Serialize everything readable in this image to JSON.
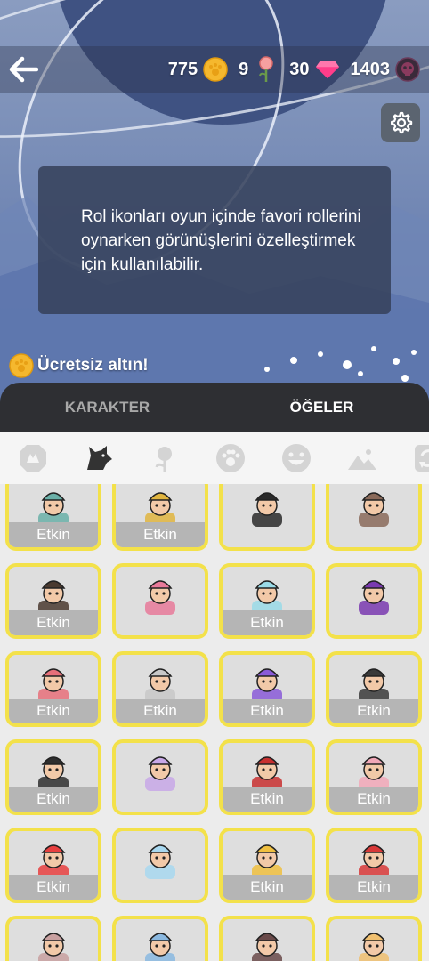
{
  "header": {
    "currency": [
      {
        "name": "gold",
        "value": "775",
        "icon": "gold-paw-coin-icon",
        "color": "#f5b82e"
      },
      {
        "name": "roses",
        "value": "9",
        "icon": "rose-icon",
        "color": "#f08a8a"
      },
      {
        "name": "gems",
        "value": "30",
        "icon": "gem-icon",
        "color": "#ff3d8a"
      },
      {
        "name": "skull-coins",
        "value": "1403",
        "icon": "skull-coin-icon",
        "color": "#7a2a4a"
      }
    ]
  },
  "info": {
    "text": "Rol ikonları oyun içinde favori rollerini oynarken görünüşlerini özelleştirmek için kullanılabilir."
  },
  "free_gold": {
    "label": "Ücretsiz altın!",
    "icon": "gold-paw-coin-icon"
  },
  "tabs": [
    {
      "label": "KARAKTER",
      "active": false
    },
    {
      "label": "ÖĞELER",
      "active": true
    }
  ],
  "categories": [
    {
      "icon": "role-shield-icon",
      "selected": false
    },
    {
      "icon": "wolf-icon",
      "selected": true
    },
    {
      "icon": "rose-icon",
      "selected": false
    },
    {
      "icon": "paw-icon",
      "selected": false
    },
    {
      "icon": "smiley-icon",
      "selected": false
    },
    {
      "icon": "landscape-icon",
      "selected": false
    },
    {
      "icon": "refresh-icon",
      "selected": false
    }
  ],
  "items": [
    {
      "icon": "doctor-icon",
      "badge": "Etkin"
    },
    {
      "icon": "detective-yellow-icon",
      "badge": "Etkin"
    },
    {
      "icon": "top-hat-gentleman-icon",
      "badge": ""
    },
    {
      "icon": "fedora-detective-icon",
      "badge": ""
    },
    {
      "icon": "girl-long-hair-icon",
      "badge": "Etkin"
    },
    {
      "icon": "skull-crystal-ball-icon",
      "badge": ""
    },
    {
      "icon": "bunny-crystal-ball-icon",
      "badge": "Etkin"
    },
    {
      "icon": "purple-crystal-ball-icon",
      "badge": ""
    },
    {
      "icon": "pink-cowboy-hat-icon",
      "badge": "Etkin"
    },
    {
      "icon": "soccer-chef-icon",
      "badge": "Etkin"
    },
    {
      "icon": "purple-crystals-icon",
      "badge": "Etkin"
    },
    {
      "icon": "camera-icon",
      "badge": "Etkin"
    },
    {
      "icon": "witch-hat-icon",
      "badge": "Etkin"
    },
    {
      "icon": "old-wizard-icon",
      "badge": ""
    },
    {
      "icon": "red-devil-icon",
      "badge": "Etkin"
    },
    {
      "icon": "pig-mask-icon",
      "badge": "Etkin"
    },
    {
      "icon": "lifebuoy-icon",
      "badge": "Etkin"
    },
    {
      "icon": "snowflake-orb-icon",
      "badge": ""
    },
    {
      "icon": "flower-glasses-icon",
      "badge": "Etkin"
    },
    {
      "icon": "red-card-icon",
      "badge": "Etkin"
    },
    {
      "icon": "tribal-mask-icon",
      "badge": ""
    },
    {
      "icon": "ice-character-icon",
      "badge": ""
    },
    {
      "icon": "pinup-girl-icon",
      "badge": ""
    },
    {
      "icon": "duck-chef-icon",
      "badge": ""
    }
  ]
}
